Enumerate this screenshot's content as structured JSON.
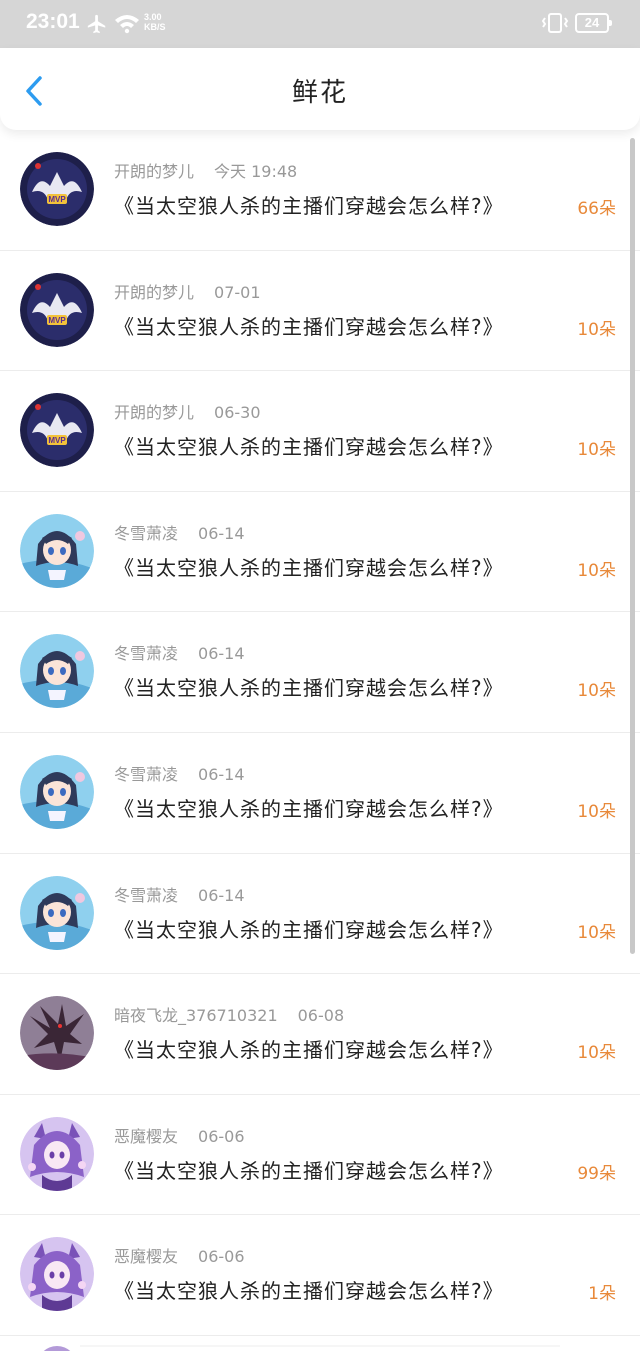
{
  "status_bar": {
    "time": "23:01",
    "net_speed_value": "3.00",
    "net_speed_unit": "KB/S",
    "battery": "24"
  },
  "header": {
    "title": "鲜花"
  },
  "colors": {
    "accent": "#2d9cf0",
    "count": "#e8893a",
    "meta": "#999999"
  },
  "items": [
    {
      "name": "开朗的梦儿",
      "date": "今天 19:48",
      "title": "《当太空狼人杀的主播们穿越会怎么样?》",
      "count": "66朵",
      "avatar": "mvp-badge"
    },
    {
      "name": "开朗的梦儿",
      "date": "07-01",
      "title": "《当太空狼人杀的主播们穿越会怎么样?》",
      "count": "10朵",
      "avatar": "mvp-badge"
    },
    {
      "name": "开朗的梦儿",
      "date": "06-30",
      "title": "《当太空狼人杀的主播们穿越会怎么样?》",
      "count": "10朵",
      "avatar": "mvp-badge"
    },
    {
      "name": "冬雪萧凌",
      "date": "06-14",
      "title": "《当太空狼人杀的主播们穿越会怎么样?》",
      "count": "10朵",
      "avatar": "anime-girl"
    },
    {
      "name": "冬雪萧凌",
      "date": "06-14",
      "title": "《当太空狼人杀的主播们穿越会怎么样?》",
      "count": "10朵",
      "avatar": "anime-girl"
    },
    {
      "name": "冬雪萧凌",
      "date": "06-14",
      "title": "《当太空狼人杀的主播们穿越会怎么样?》",
      "count": "10朵",
      "avatar": "anime-girl"
    },
    {
      "name": "冬雪萧凌",
      "date": "06-14",
      "title": "《当太空狼人杀的主播们穿越会怎么样?》",
      "count": "10朵",
      "avatar": "anime-girl"
    },
    {
      "name": "暗夜飞龙_376710321",
      "date": "06-08",
      "title": "《当太空狼人杀的主播们穿越会怎么样?》",
      "count": "10朵",
      "avatar": "dark-dragon"
    },
    {
      "name": "恶魔樱友",
      "date": "06-06",
      "title": "《当太空狼人杀的主播们穿越会怎么样?》",
      "count": "99朵",
      "avatar": "purple-demon"
    },
    {
      "name": "恶魔樱友",
      "date": "06-06",
      "title": "《当太空狼人杀的主播们穿越会怎么样?》",
      "count": "1朵",
      "avatar": "purple-demon"
    }
  ]
}
